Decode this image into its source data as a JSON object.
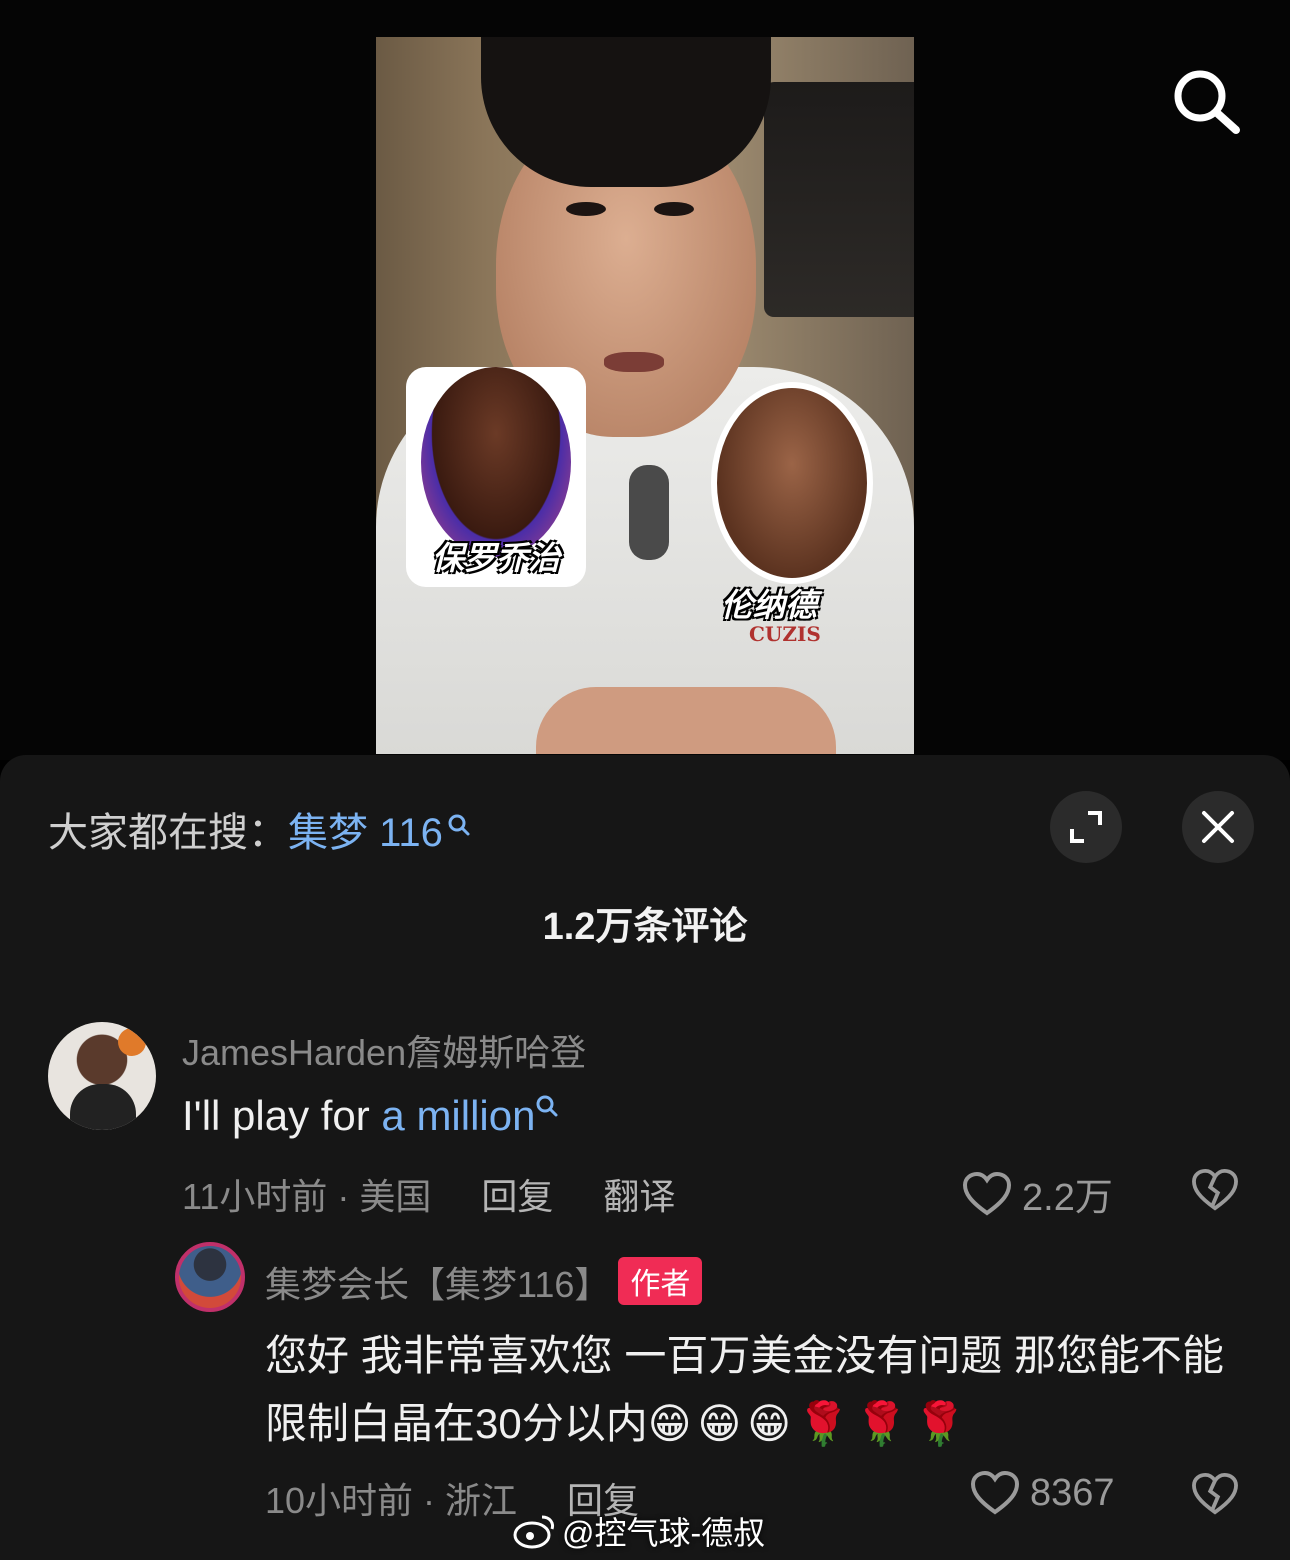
{
  "trending": {
    "prefix": "大家都在搜：",
    "keyword": "集梦 116"
  },
  "video": {
    "sticker_left_label": "保罗乔治",
    "sticker_right_label": "伦纳德",
    "shirt_print": "CUZIS"
  },
  "comment_count": "1.2万条评论",
  "comments": [
    {
      "username": "JamesHarden詹姆斯哈登",
      "text_prefix": "I'll play for ",
      "text_link": "a million",
      "time_location": "11小时前 · 美国",
      "reply_label": "回复",
      "translate_label": "翻译",
      "likes": "2.2万"
    },
    {
      "username": "集梦会长【集梦116】",
      "badge": "作者",
      "text": "您好 我非常喜欢您 一百万美金没有问题 那您能不能限制白晶在30分以内",
      "emojis": "😁😁😁🌹🌹🌹",
      "time_location": "10小时前 · 浙江",
      "reply_label": "回复",
      "likes": "8367"
    }
  ],
  "watermark": "@控气球-德叔",
  "colors": {
    "sheet_bg": "#161616",
    "link_blue": "#7cb3f2",
    "author_badge": "#f02c55"
  }
}
